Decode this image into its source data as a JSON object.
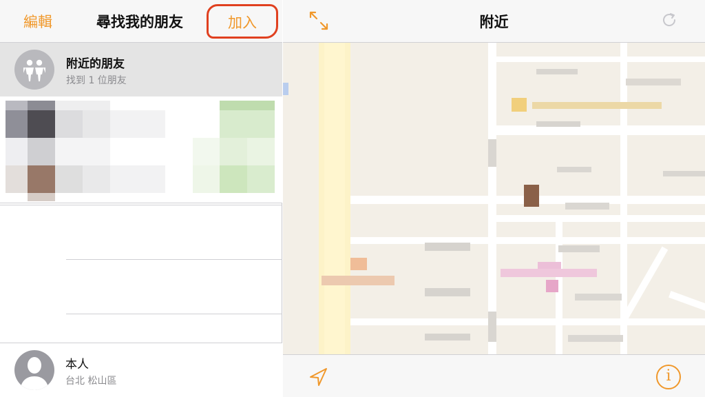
{
  "left_nav": {
    "edit_label": "編輯",
    "title": "尋找我的朋友",
    "add_label": "加入"
  },
  "nearby": {
    "title": "附近的朋友",
    "subtitle": "找到 1 位朋友"
  },
  "me": {
    "name": "本人",
    "location": "台北 松山區"
  },
  "map_nav": {
    "title": "附近"
  },
  "toolbar": {
    "info_label": "i"
  },
  "icons": {
    "expand": "expand-icon",
    "refresh": "refresh-icon",
    "location": "location-arrow-icon",
    "info": "info-icon",
    "friends": "friends-icon",
    "person": "person-silhouette-icon"
  },
  "colors": {
    "accent": "#f0982b",
    "highlight_circle": "#e0401f",
    "selected_row": "#e4e4e4",
    "map_bg": "#f3efe7"
  }
}
